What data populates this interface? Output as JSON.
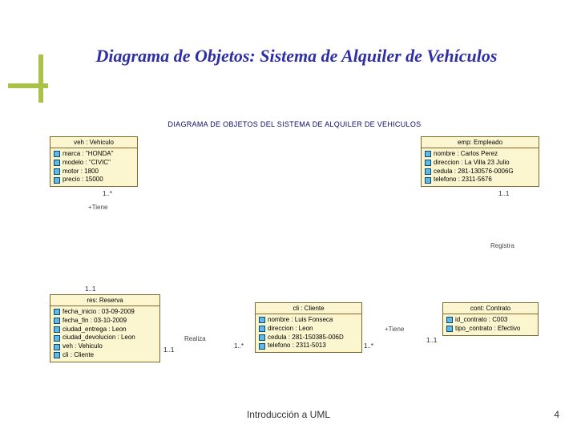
{
  "title": "Diagrama de Objetos: Sistema de Alquiler de Vehículos",
  "subtitle": "DIAGRAMA DE OBJETOS DEL SISTEMA DE ALQUILER DE VEHICULOS",
  "footer": "Introducción a UML",
  "page_number": "4",
  "relations": {
    "tiene1": "+Tiene",
    "realiza": "Realiza",
    "tiene2": "+Tiene",
    "registra": "Registra"
  },
  "mults": {
    "m11a": "1..*",
    "m11b": "1..1",
    "m11c": "1..1",
    "m11d": "1..*",
    "m11e": "1..*",
    "m11f": "1..1",
    "m11g": "1..1"
  },
  "objects": {
    "veh": {
      "header": "veh : Vehiculo",
      "attrs": [
        "marca : \"HONDA\"",
        "modelo : \"CIVIC\"",
        "motor : 1800",
        "precio : 15000"
      ]
    },
    "emp": {
      "header": "emp: Empleado",
      "attrs": [
        "nombre : Carlos Perez",
        "direccion : La Villa 23 Julio",
        "cedula : 281-130576-0006G",
        "telefono : 2311-5676"
      ]
    },
    "res": {
      "header": "res: Reserva",
      "attrs": [
        "fecha_inicio : 03-09-2009",
        "fecha_fin : 03-10-2009",
        "ciudad_entrega : Leon",
        "ciudad_devolucion : Leon",
        "veh : Vehiculo",
        "cli : Cliente"
      ]
    },
    "cli": {
      "header": "cli : Cliente",
      "attrs": [
        "nombre : Luis Fonseca",
        "direccion : Leon",
        "cedula : 281-150385-006D",
        "telefono : 2311-5013"
      ]
    },
    "cont": {
      "header": "cont: Contrato",
      "attrs": [
        "id_contrato : C003",
        "tipo_contrato : Efectivo"
      ]
    }
  }
}
